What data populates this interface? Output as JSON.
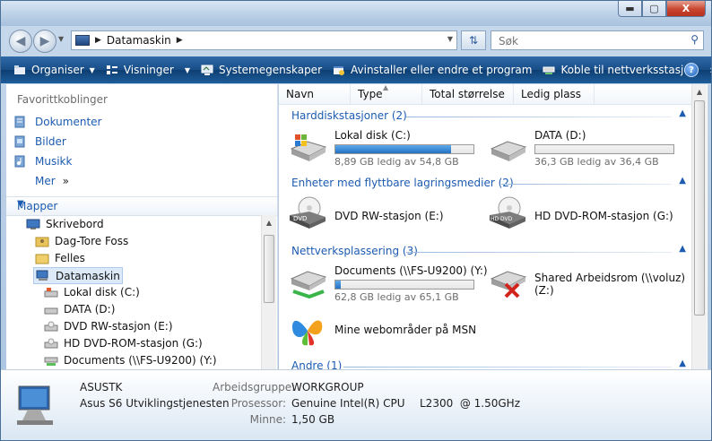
{
  "window": {
    "min_label": "▬",
    "max_label": "▢",
    "close_label": "X"
  },
  "address": {
    "crumb": "Datamaskin"
  },
  "search": {
    "placeholder": "Søk"
  },
  "toolbar": {
    "organize": "Organiser",
    "views": "Visninger",
    "system_properties": "Systemegenskaper",
    "uninstall": "Avinstaller eller endre et program",
    "map_drive": "Koble til nettverksstasjon",
    "more": "»",
    "help": "?"
  },
  "nav": {
    "favorites_title": "Favorittkoblinger",
    "favorites": [
      {
        "label": "Dokumenter"
      },
      {
        "label": "Bilder"
      },
      {
        "label": "Musikk"
      },
      {
        "label": "Mer"
      }
    ],
    "more_arrow": "»",
    "folders_title": "Mapper",
    "tree": [
      {
        "label": "Skrivebord"
      },
      {
        "label": "Dag-Tore Foss"
      },
      {
        "label": "Felles"
      },
      {
        "label": "Datamaskin"
      },
      {
        "label": "Lokal disk (C:)"
      },
      {
        "label": "DATA (D:)"
      },
      {
        "label": "DVD RW-stasjon (E:)"
      },
      {
        "label": "HD DVD-ROM-stasjon (G:)"
      },
      {
        "label": "Documents (\\\\FS-U9200) (Y:)"
      }
    ]
  },
  "columns": [
    "Navn",
    "Type",
    "Total størrelse",
    "Ledig plass"
  ],
  "groups": [
    {
      "label": "Harddiskstasjoner (2)"
    },
    {
      "label": "Enheter med flyttbare lagringsmedier (2)"
    },
    {
      "label": "Nettverksplassering (3)"
    },
    {
      "label": "Andre (1)"
    }
  ],
  "drives": {
    "c": {
      "name": "Lokal disk (C:)",
      "free_text": "8,89 GB ledig av 54,8 GB",
      "used_fraction": 0.84
    },
    "d": {
      "name": "DATA (D:)",
      "free_text": "36,3 GB ledig av 36,4 GB",
      "used_fraction": 0.0
    },
    "e": {
      "name": "DVD RW-stasjon (E:)",
      "badge": "DVD"
    },
    "g": {
      "name": "HD DVD-ROM-stasjon (G:)",
      "badge": "HD DVD"
    },
    "y": {
      "name": "Documents (\\\\FS-U9200) (Y:)",
      "free_text": "62,8 GB ledig av 65,1 GB",
      "used_fraction": 0.04
    },
    "z": {
      "name": "Shared Arbeidsrom (\\\\voluz)",
      "name2": "(Z:)"
    },
    "msn": {
      "name": "Mine webområder på MSN"
    }
  },
  "details": {
    "computer_name": "ASUSTK",
    "computer_desc": "Asus S6 Utviklingstjenesten",
    "workgroup_label": "Arbeidsgruppe:",
    "workgroup": "WORKGROUP",
    "processor_label": "Prosessor:",
    "processor": "Genuine Intel(R) CPU",
    "processor_model": "L2300  @ 1.50GHz",
    "memory_label": "Minne:",
    "memory": "1,50 GB"
  }
}
